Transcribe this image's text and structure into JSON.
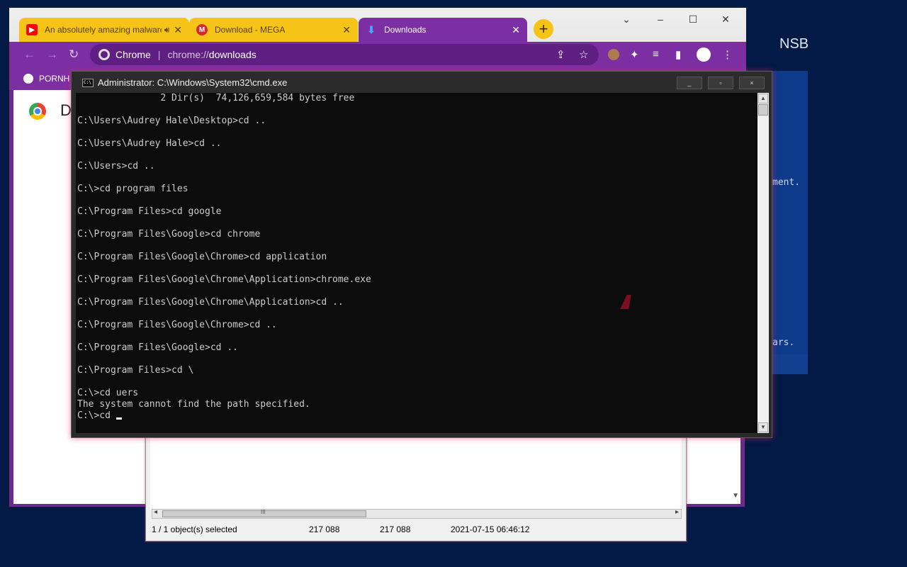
{
  "desktop": {
    "label": "NSB"
  },
  "background_window": {
    "lines": [
      "ment.",
      "ars."
    ]
  },
  "chrome": {
    "tabs": [
      {
        "label": "An absolutely amazing malware",
        "favicon": "youtube-icon",
        "active": false,
        "audio": true
      },
      {
        "label": "Download - MEGA",
        "favicon": "mega-icon",
        "active": false
      },
      {
        "label": "Downloads",
        "favicon": "download-icon",
        "active": true
      }
    ],
    "newtab_label": "+",
    "window_controls": {
      "minimize": "–",
      "maximize": "☐",
      "close": "✕",
      "tab_search": "⌄"
    },
    "omnibox": {
      "site_label": "Chrome",
      "separator": "|",
      "url_scheme": "chrome://",
      "url_host": "downloads"
    },
    "bookmarks": [
      {
        "label": "PORNH"
      }
    ],
    "page": {
      "title": "D"
    }
  },
  "explorer": {
    "status": {
      "selection": "1 / 1 object(s) selected",
      "size": "217 088",
      "packed": "217 088",
      "modified": "2021-07-15 06:46:12"
    },
    "scroll_thumb_grip": "III"
  },
  "cmd": {
    "title": "Administrator: C:\\Windows\\System32\\cmd.exe",
    "icon_text": "C:\\",
    "controls": {
      "minimize": "_",
      "maximize": "▫",
      "close": "×"
    },
    "console_text": "               2 Dir(s)  74,126,659,584 bytes free\n\nC:\\Users\\Audrey Hale\\Desktop>cd ..\n\nC:\\Users\\Audrey Hale>cd ..\n\nC:\\Users>cd ..\n\nC:\\>cd program files\n\nC:\\Program Files>cd google\n\nC:\\Program Files\\Google>cd chrome\n\nC:\\Program Files\\Google\\Chrome>cd application\n\nC:\\Program Files\\Google\\Chrome\\Application>chrome.exe\n\nC:\\Program Files\\Google\\Chrome\\Application>cd ..\n\nC:\\Program Files\\Google\\Chrome>cd ..\n\nC:\\Program Files\\Google>cd ..\n\nC:\\Program Files>cd \\\n\nC:\\>cd uers\nThe system cannot find the path specified.\n",
    "prompt": "C:\\>cd "
  }
}
